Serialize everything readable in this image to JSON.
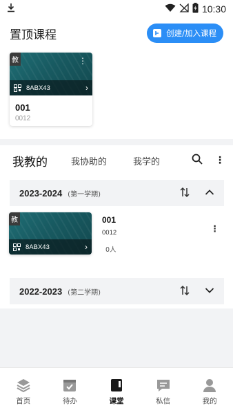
{
  "status_bar": {
    "time": "10:30"
  },
  "pinned": {
    "title": "置顶课程",
    "create_label": "创建/加入课程",
    "course": {
      "tag": "教",
      "code": "8ABX43",
      "name": "001",
      "number": "0012"
    }
  },
  "tabs": [
    {
      "label": "我教的"
    },
    {
      "label": "我协助的"
    },
    {
      "label": "我学的"
    }
  ],
  "terms": [
    {
      "year": "2023-2024",
      "semester": "(第一学期)",
      "course": {
        "tag": "教",
        "code": "8ABX43",
        "name": "001",
        "number": "0012",
        "students": "0人"
      }
    },
    {
      "year": "2022-2023",
      "semester": "(第二学期)"
    }
  ],
  "bottom_nav": [
    {
      "label": "首页",
      "icon": "home-icon"
    },
    {
      "label": "待办",
      "icon": "todo-icon"
    },
    {
      "label": "课堂",
      "icon": "classroom-icon"
    },
    {
      "label": "私信",
      "icon": "message-icon"
    },
    {
      "label": "我的",
      "icon": "profile-icon"
    }
  ],
  "colors": {
    "accent": "#2b8ef6",
    "card": "#1f6d74"
  }
}
